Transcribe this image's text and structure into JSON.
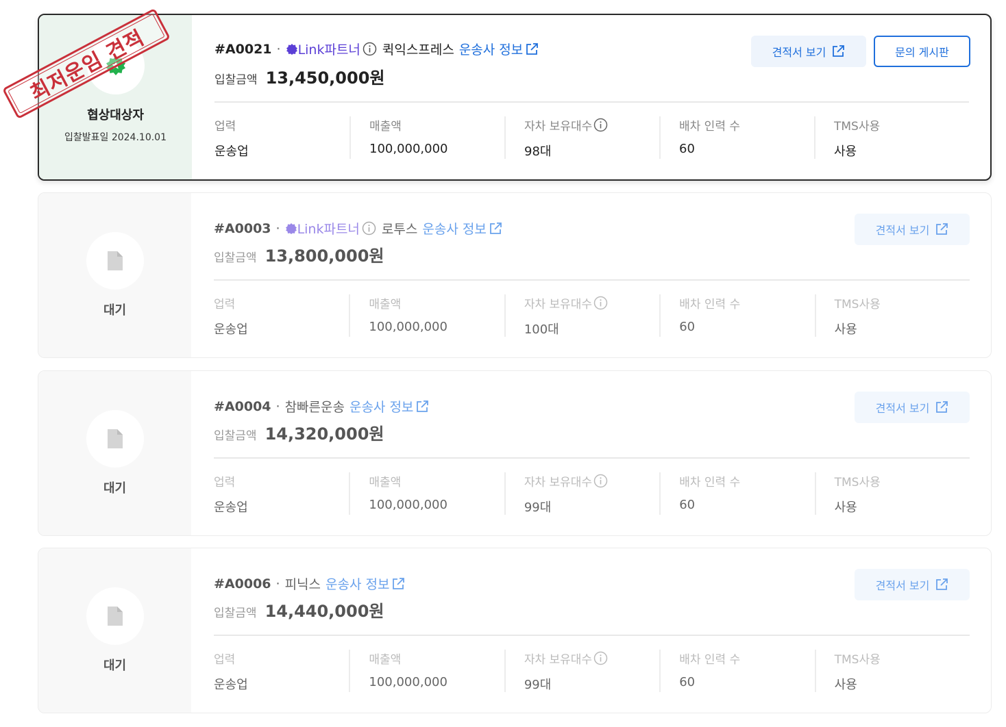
{
  "ribbon": {
    "text": "최저운임 견적"
  },
  "labels": {
    "amount": "입찰금액",
    "career": "업력",
    "sales": "매출액",
    "vehicles": "자차 보유대수",
    "dispatch": "배차 인력 수",
    "tms": "TMS사용",
    "carrier_info": "운송사 정보",
    "view_quote": "견적서 보기",
    "inquiry_board": "문의 게시판",
    "partner": "Link파트너",
    "separator": "·"
  },
  "colors": {
    "accent": "#1f6fdc",
    "partner": "#5b3fd6",
    "selected_bg": "#ebf4ee",
    "badge_green": "#22b14c",
    "ribbon": "#c9303a"
  },
  "bids": [
    {
      "status": "협상대상자",
      "date": "입찰발표일 2024.10.01",
      "status_icon": "green-badge-star-icon",
      "id": "#A0021",
      "partner": true,
      "company": "퀵익스프레스",
      "amount": "13,450,000원",
      "career": "운송업",
      "sales": "100,000,000",
      "vehicles": "98대",
      "dispatch": "60",
      "tms": "사용"
    },
    {
      "status": "대기",
      "status_icon": "document-icon",
      "id": "#A0003",
      "partner": true,
      "company": "로투스",
      "amount": "13,800,000원",
      "career": "운송업",
      "sales": "100,000,000",
      "vehicles": "100대",
      "dispatch": "60",
      "tms": "사용"
    },
    {
      "status": "대기",
      "status_icon": "document-icon",
      "id": "#A0004",
      "partner": false,
      "company": "참빠른운송",
      "amount": "14,320,000원",
      "career": "운송업",
      "sales": "100,000,000",
      "vehicles": "99대",
      "dispatch": "60",
      "tms": "사용"
    },
    {
      "status": "대기",
      "status_icon": "document-icon",
      "id": "#A0006",
      "partner": false,
      "company": "피닉스",
      "amount": "14,440,000원",
      "career": "운송업",
      "sales": "100,000,000",
      "vehicles": "99대",
      "dispatch": "60",
      "tms": "사용"
    }
  ]
}
